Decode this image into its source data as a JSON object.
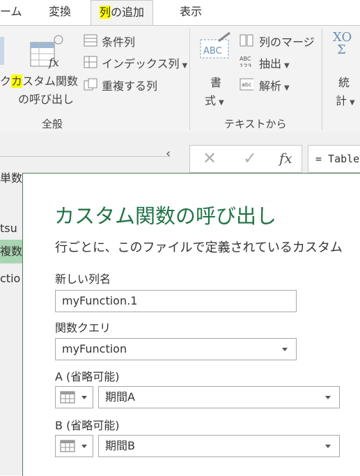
{
  "tabs": {
    "home": "ーム",
    "transform": "変換",
    "add_column_hl": "列",
    "add_column_rest": "の追加",
    "view": "表示"
  },
  "ribbon": {
    "custom_fn_hl": "カ",
    "custom_fn_line1": "スタム関数",
    "custom_fn_line2": "の呼び出し",
    "left_fragment": "ク",
    "conditional_column": "条件列",
    "index_column": "インデックス列",
    "duplicate_column": "重複する列",
    "group_general": "全般",
    "format_line1": "書",
    "format_line2": "式",
    "merge_columns": "列のマージ",
    "extract": "抽出",
    "parse": "解析",
    "group_text": "テキストから",
    "stats_line1": "統",
    "stats_line2": "計",
    "abc_icon_text": "ABC",
    "abc123_top": "ABC",
    "abc123_bottom": "123",
    "sigma_text": "XO"
  },
  "nav": {
    "item1": "単数",
    "item2": "tsu",
    "item3": "複数",
    "item4": "ctio"
  },
  "formula": {
    "fx": "fx",
    "text": "= Table"
  },
  "dialog": {
    "title": "カスタム関数の呼び出し",
    "description": "行ごとに、このファイルで定義されているカスタム",
    "new_column_label": "新しい列名",
    "new_column_value": "myFunction.1",
    "query_label": "関数クエリ",
    "query_value": "myFunction",
    "param_a_label": "A (省略可能)",
    "param_a_value": "期間A",
    "param_b_label": "B (省略可能)",
    "param_b_value": "期間B"
  },
  "colors": {
    "title_green": "#217346",
    "highlight": "#ffff00",
    "selected_row": "#a9d5b3"
  }
}
